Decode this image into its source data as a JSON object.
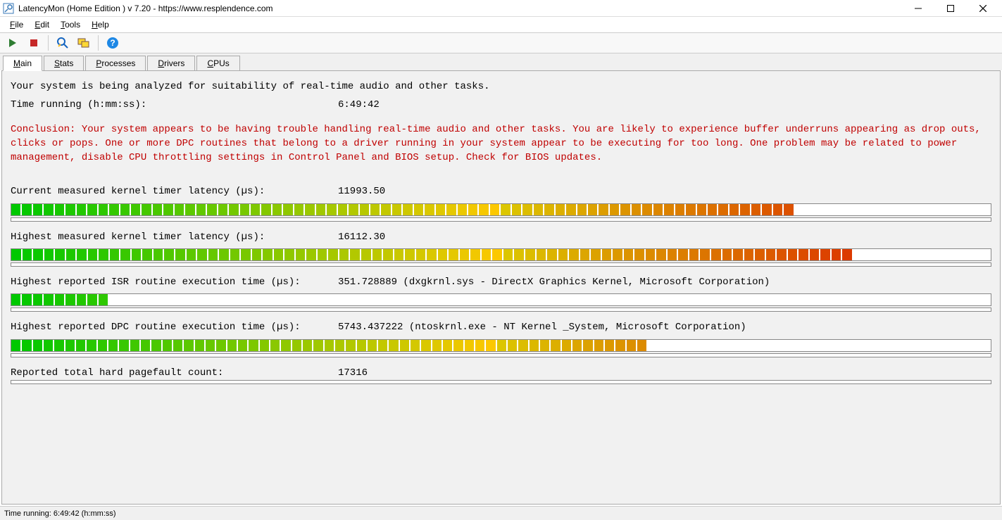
{
  "window": {
    "title": "LatencyMon  (Home Edition )  v 7.20 - https://www.resplendence.com"
  },
  "menu": {
    "file": "File",
    "edit": "Edit",
    "tools": "Tools",
    "help": "Help"
  },
  "tabs": {
    "main": "Main",
    "stats": "Stats",
    "processes": "Processes",
    "drivers": "Drivers",
    "cpus": "CPUs"
  },
  "main": {
    "intro": "Your system is being analyzed for suitability of real-time audio and other tasks.",
    "time_label": "Time running (h:mm:ss):",
    "time_value": "6:49:42",
    "conclusion": "Conclusion: Your system appears to be having trouble handling real-time audio and other tasks. You are likely to experience buffer underruns appearing as drop outs, clicks or pops. One or more DPC routines that belong to a driver running in your system appear to be executing for too long. One problem may be related to power management, disable CPU throttling settings in Control Panel and BIOS setup. Check for BIOS updates.",
    "metrics": [
      {
        "label": "Current measured kernel timer latency (µs):",
        "value": "11993.50",
        "detail": "",
        "fill": 80
      },
      {
        "label": "Highest measured kernel timer latency (µs):",
        "value": "16112.30",
        "detail": "",
        "fill": 86
      },
      {
        "label": "Highest reported ISR routine execution time (µs):",
        "value": "351.728889",
        "detail": "  (dxgkrnl.sys - DirectX Graphics Kernel, Microsoft Corporation)",
        "fill": 10
      },
      {
        "label": "Highest reported DPC routine execution time (µs):",
        "value": "5743.437222",
        "detail": "  (ntoskrnl.exe - NT Kernel _System, Microsoft Corporation)",
        "fill": 65
      },
      {
        "label": "Reported total hard pagefault count:",
        "value": "17316",
        "detail": "",
        "fill": 0
      }
    ]
  },
  "status": {
    "text": "Time running: 6:49:42  (h:mm:ss)"
  }
}
